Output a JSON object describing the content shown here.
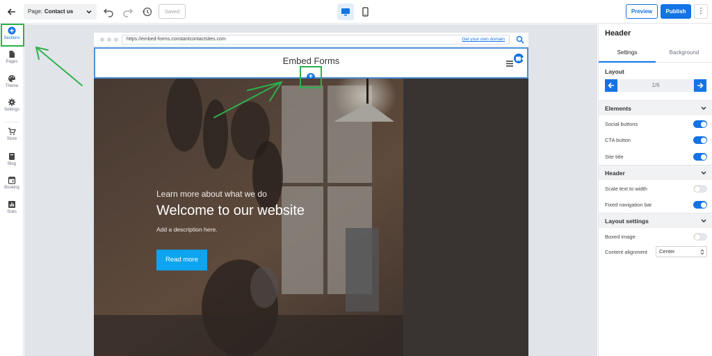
{
  "topbar": {
    "page_label": "Page:",
    "page_value": "Contact us",
    "saved_label": "Saved",
    "preview_label": "Preview",
    "publish_label": "Publish",
    "more_label": "⋮"
  },
  "sidebar": {
    "items": [
      {
        "label": "Sections",
        "icon": "plus-circle-icon"
      },
      {
        "label": "Pages",
        "icon": "page-icon"
      },
      {
        "label": "Theme",
        "icon": "palette-icon"
      },
      {
        "label": "Settings",
        "icon": "gear-icon"
      },
      {
        "label": "Store",
        "icon": "cart-icon"
      },
      {
        "label": "Blog",
        "icon": "book-icon"
      },
      {
        "label": "Booking",
        "icon": "calendar-icon"
      },
      {
        "label": "Stats",
        "icon": "chart-icon"
      }
    ]
  },
  "browser": {
    "url": "https://embed-forms.constantcontactsites.com",
    "own_domain_label": "Get your own domain"
  },
  "site": {
    "title": "Embed Forms",
    "hero": {
      "kicker": "Learn more about what we do",
      "title": "Welcome to our website",
      "description": "Add a description here.",
      "cta_label": "Read more"
    }
  },
  "panel": {
    "title": "Header",
    "tabs": [
      {
        "label": "Settings"
      },
      {
        "label": "Background"
      }
    ],
    "layout_label": "Layout",
    "layout_value": "1/6",
    "groups": {
      "elements": "Elements",
      "header": "Header",
      "layout_settings": "Layout settings"
    },
    "rows": {
      "social_buttons": {
        "label": "Social buttons",
        "on": true
      },
      "cta_button": {
        "label": "CTA button",
        "on": true
      },
      "site_title": {
        "label": "Site title",
        "on": true
      },
      "scale_text": {
        "label": "Scale text to width",
        "on": false
      },
      "fixed_nav": {
        "label": "Fixed navigation bar",
        "on": true
      },
      "boxed_image": {
        "label": "Boxed image",
        "on": false
      },
      "content_alignment": {
        "label": "Content alignment",
        "value": "Center"
      }
    }
  },
  "colors": {
    "accent": "#1473e6",
    "annotation": "#2db14b",
    "cta": "#0da4f0"
  }
}
